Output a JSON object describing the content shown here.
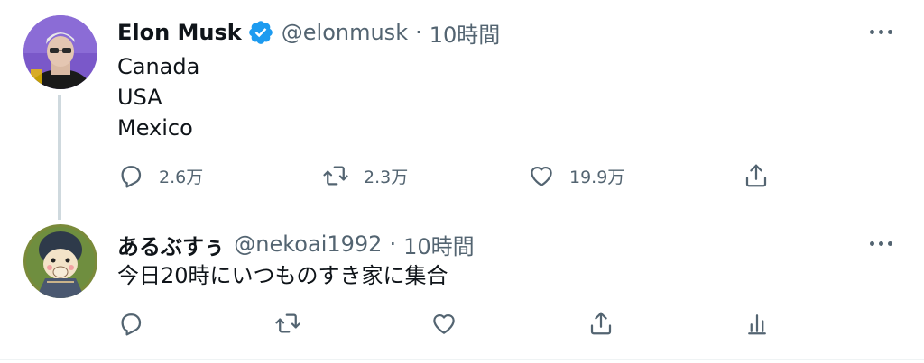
{
  "tweets": [
    {
      "author_name": "Elon Musk",
      "verified": true,
      "handle": "@elonmusk",
      "separator": "·",
      "time": "10時間",
      "text": "Canada\nUSA\nMexico",
      "replies": "2.6万",
      "retweets": "2.3万",
      "likes": "19.9万"
    },
    {
      "author_name": "あるぶすぅ",
      "verified": false,
      "handle": "@nekoai1992",
      "separator": "·",
      "time": "10時間",
      "text": "今日20時にいつものすき家に集合"
    }
  ],
  "colors": {
    "text_primary": "#0f1419",
    "text_secondary": "#536471",
    "verified_blue": "#1d9bf0",
    "thread_line": "#cfd9de"
  },
  "icons": [
    "verified-badge-icon",
    "reply-icon",
    "retweet-icon",
    "like-icon",
    "share-icon",
    "analytics-icon",
    "more-icon"
  ]
}
